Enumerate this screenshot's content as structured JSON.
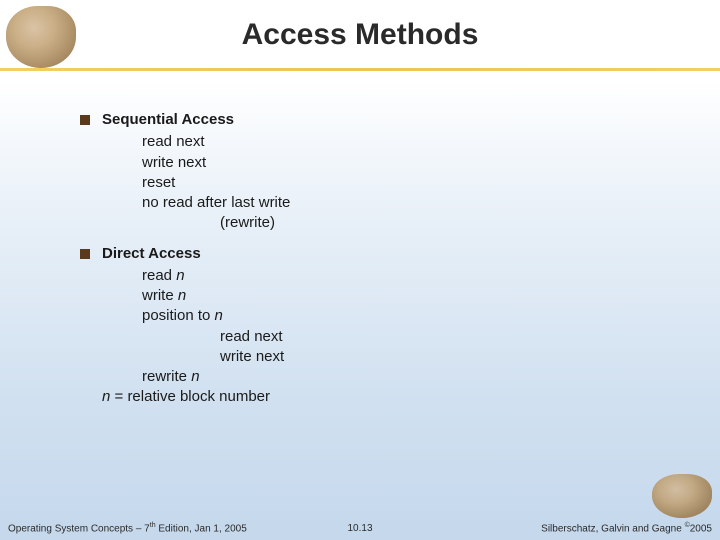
{
  "title": "Access Methods",
  "sections": [
    {
      "heading": "Sequential Access",
      "lines1": [
        "read next",
        "write next",
        "reset",
        "no read after last write"
      ],
      "lines2": [
        "(rewrite)"
      ],
      "tail": null
    },
    {
      "heading": "Direct Access",
      "lines1": [
        "read n",
        "write n",
        "position to n"
      ],
      "lines2": [
        "read next",
        "write next"
      ],
      "lines1b": [
        "rewrite n"
      ],
      "tail": "n = relative block number"
    }
  ],
  "footer": {
    "left_prefix": "Operating System Concepts – 7",
    "left_sup": "th",
    "left_suffix": " Edition, Jan 1, 2005",
    "center": "10.13",
    "right_prefix": "Silberschatz, Galvin and Gagne ",
    "right_sup": "©",
    "right_suffix": "2005"
  }
}
